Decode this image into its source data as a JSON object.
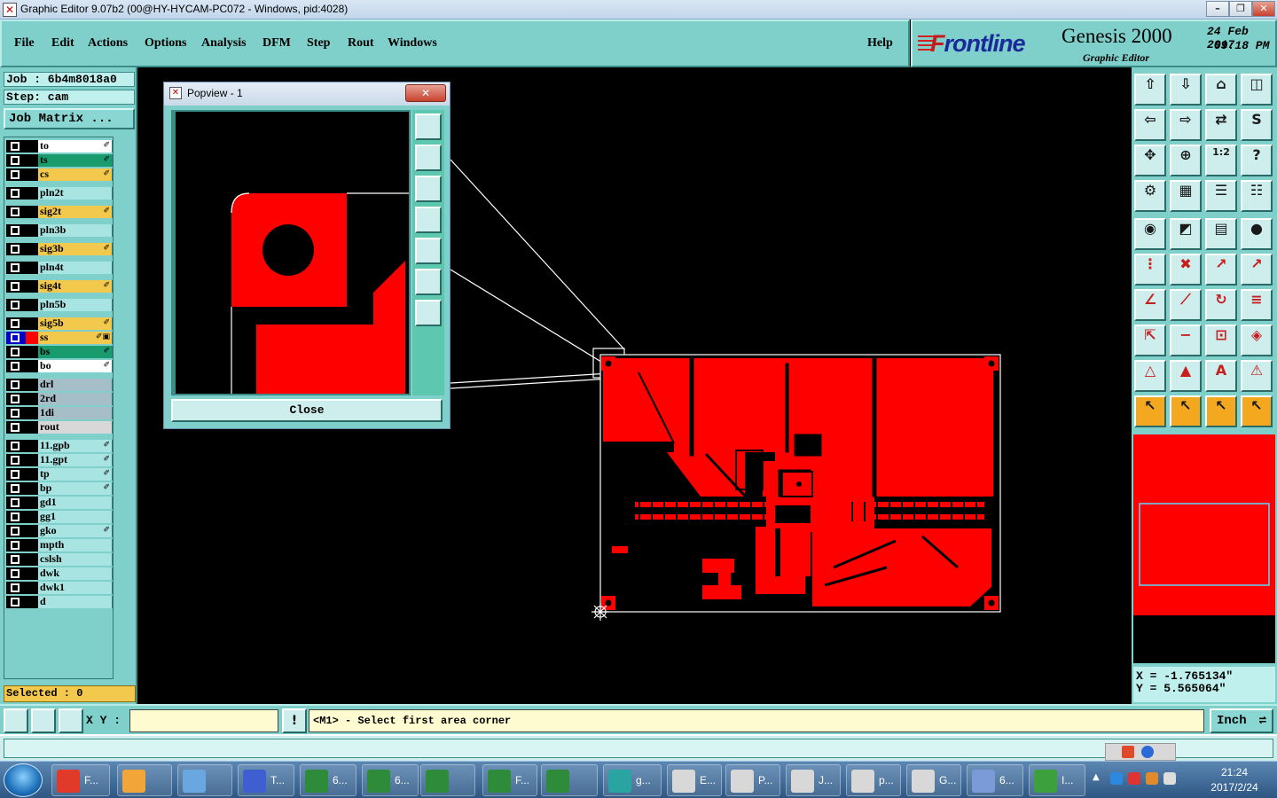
{
  "window": {
    "title": "Graphic Editor 9.07b2 (00@HY-HYCAM-PC072 - Windows, pid:4028)",
    "min_label": "–",
    "max_label": "❐",
    "close_label": "✕"
  },
  "menu": {
    "items": [
      "File",
      "Edit",
      "Actions",
      "Options",
      "Analysis",
      "DFM",
      "Step",
      "Rout",
      "Windows"
    ],
    "help": "Help"
  },
  "logo": {
    "brand_prefix": "F",
    "brand": "rontline",
    "product": "Genesis 2000",
    "subtitle": "Graphic Editor",
    "date": "24 Feb 2017",
    "time": "09:18 PM"
  },
  "job": {
    "job_label": "Job : 6b4m8018a0",
    "step_label": "Step: cam",
    "matrix_button": "Job Matrix ...",
    "selected_label": "Selected : 0"
  },
  "layers": [
    {
      "name": "to",
      "color": "#ffffff",
      "flag": "✐",
      "group": 0
    },
    {
      "name": "ts",
      "color": "#1a9b6e",
      "flag": "✐",
      "group": 0
    },
    {
      "name": "cs",
      "color": "#f3c94d",
      "flag": "✐",
      "group": 0
    },
    {
      "name": "pln2t",
      "color": "#a8e4e1",
      "flag": "",
      "group": 1
    },
    {
      "name": "sig2t",
      "color": "#f3c94d",
      "flag": "✐",
      "group": 1
    },
    {
      "name": "pln3b",
      "color": "#a8e4e1",
      "flag": "",
      "group": 1
    },
    {
      "name": "sig3b",
      "color": "#f3c94d",
      "flag": "✐",
      "group": 1
    },
    {
      "name": "pln4t",
      "color": "#a8e4e1",
      "flag": "",
      "group": 1
    },
    {
      "name": "sig4t",
      "color": "#f3c94d",
      "flag": "✐",
      "group": 1
    },
    {
      "name": "pln5b",
      "color": "#a8e4e1",
      "flag": "",
      "group": 1
    },
    {
      "name": "sig5b",
      "color": "#f3c94d",
      "flag": "✐",
      "group": 2
    },
    {
      "name": "ss",
      "color": "#f3c94d",
      "flag": "✐▣",
      "group": 2,
      "selected": true
    },
    {
      "name": "bs",
      "color": "#1a9b6e",
      "flag": "✐",
      "group": 2
    },
    {
      "name": "bo",
      "color": "#ffffff",
      "flag": "✐",
      "group": 2
    },
    {
      "name": "drl",
      "color": "#a6bec8",
      "flag": "",
      "group": 3
    },
    {
      "name": "2rd",
      "color": "#a6bec8",
      "flag": "",
      "group": 3
    },
    {
      "name": "1di",
      "color": "#a6bec8",
      "flag": "",
      "group": 3
    },
    {
      "name": "rout",
      "color": "#d8d8d8",
      "flag": "",
      "group": 3
    },
    {
      "name": "11.gpb",
      "color": "#a8e4e1",
      "flag": "✐",
      "group": 4
    },
    {
      "name": "11.gpt",
      "color": "#a8e4e1",
      "flag": "✐",
      "group": 4
    },
    {
      "name": "tp",
      "color": "#a8e4e1",
      "flag": "✐",
      "group": 4
    },
    {
      "name": "bp",
      "color": "#a8e4e1",
      "flag": "✐",
      "group": 4
    },
    {
      "name": "gd1",
      "color": "#a8e4e1",
      "flag": "",
      "group": 4
    },
    {
      "name": "gg1",
      "color": "#a8e4e1",
      "flag": "",
      "group": 4
    },
    {
      "name": "gko",
      "color": "#a8e4e1",
      "flag": "✐",
      "group": 4
    },
    {
      "name": "mpth",
      "color": "#a8e4e1",
      "flag": "",
      "group": 4
    },
    {
      "name": "cslsh",
      "color": "#a8e4e1",
      "flag": "",
      "group": 4
    },
    {
      "name": "dwk",
      "color": "#a8e4e1",
      "flag": "",
      "group": 4
    },
    {
      "name": "dwk1",
      "color": "#a8e4e1",
      "flag": "",
      "group": 4
    },
    {
      "name": "d",
      "color": "#a8e4e1",
      "flag": "",
      "group": 4
    }
  ],
  "popview": {
    "title": "Popview - 1",
    "close_x": "✕",
    "close_button": "Close"
  },
  "toolbar_icons": [
    "window-icon",
    "window-down-icon",
    "home-icon",
    "split-icon",
    "page-left-icon",
    "page-right-icon",
    "swap-icon",
    "curve-icon",
    "zoom-fit-icon",
    "zoom-center-icon",
    "ratio-icon",
    "question-icon",
    "measure-icon",
    "grid-icon",
    "layers-icon",
    "layers-alt-icon",
    "pad-icon",
    "line-color-icon",
    "ruler-icon",
    "dot-icon",
    "net-icon",
    "cross-icon",
    "line-add-icon",
    "line-edit-icon",
    "angle-icon",
    "slash-icon",
    "arc-icon",
    "text-align-icon",
    "pad-move-icon",
    "line-cut-icon",
    "fit-box-icon",
    "shapes-icon",
    "triangle-icon",
    "triangle-up-icon",
    "triangle-a-icon",
    "triangle-sym-icon",
    "pointer-icon",
    "pointer-box-icon",
    "pointer-circle-icon",
    "pointer-net-icon"
  ],
  "toolbar_ratio_text": "1:2",
  "toolbar_q_text": "?",
  "coords": {
    "x": "X = -1.765134\"",
    "y": "Y = 5.565064\""
  },
  "cmd": {
    "xy_label": "X Y :",
    "xy_value": "",
    "bang": "!",
    "prompt": "<M1> - Select first area corner",
    "unit": "Inch",
    "unit_arrow": "⇌"
  },
  "taskbar": {
    "tasks": [
      {
        "label": "F...",
        "icon": "genesis-icon",
        "color": "#e23a2a"
      },
      {
        "label": "",
        "icon": "shell-icon",
        "color": "#f2a63a"
      },
      {
        "label": "",
        "icon": "notepad-icon",
        "color": "#6aa7e0"
      },
      {
        "label": "T...",
        "icon": "save-icon",
        "color": "#3f5fd0"
      },
      {
        "label": "6...",
        "icon": "excel-icon",
        "color": "#2e8b3a"
      },
      {
        "label": "6...",
        "icon": "excel-icon",
        "color": "#2e8b3a"
      },
      {
        "label": "",
        "icon": "excel-icon",
        "color": "#2e8b3a"
      },
      {
        "label": "F...",
        "icon": "excel-icon",
        "color": "#2e8b3a"
      },
      {
        "label": "",
        "icon": "excel-icon",
        "color": "#2e8b3a"
      },
      {
        "label": "g...",
        "icon": "eye-icon",
        "color": "#2aa4a0"
      },
      {
        "label": "E...",
        "icon": "x-window-icon",
        "color": "#d8d8d8"
      },
      {
        "label": "P...",
        "icon": "x-window-icon",
        "color": "#d8d8d8"
      },
      {
        "label": "J...",
        "icon": "x-window-icon",
        "color": "#d8d8d8"
      },
      {
        "label": "p...",
        "icon": "x-window-icon",
        "color": "#d8d8d8"
      },
      {
        "label": "G...",
        "icon": "x-window-icon",
        "color": "#d8d8d8"
      },
      {
        "label": "6...",
        "icon": "text-doc-icon",
        "color": "#7a9ad8"
      },
      {
        "label": "I...",
        "icon": "frontline-icon",
        "color": "#3ca03c"
      }
    ],
    "time": "21:24",
    "date": "2017/2/24"
  },
  "colors": {
    "panel": "#7fcfcb",
    "copper": "#ff0000",
    "highlight": "#f3a820"
  }
}
